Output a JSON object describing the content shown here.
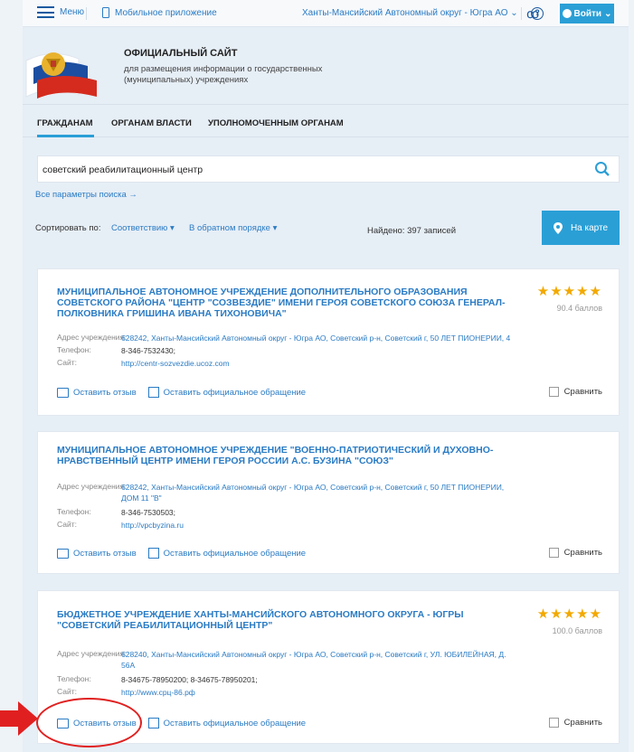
{
  "topbar": {
    "menu_label": "Меню",
    "mobile_label": "Мобильное приложение",
    "region": "Ханты-Мансийский Автономный округ - Югра АО",
    "login_label": "Войти"
  },
  "header": {
    "title": "ОФИЦИАЛЬНЫЙ САЙТ",
    "subtitle_line1": "для размещения информации о государственных",
    "subtitle_line2": "(муниципальных) учреждениях"
  },
  "nav": {
    "items": [
      "ГРАЖДАНАМ",
      "ОРГАНАМ ВЛАСТИ",
      "УПОЛНОМОЧЕННЫМ ОРГАНАМ"
    ],
    "active": "ГРАЖДАНАМ"
  },
  "search": {
    "value": "советский реабилитационный центр",
    "all_params": "Все параметры поиска →"
  },
  "sort": {
    "label": "Сортировать по:",
    "option1": "Соответствию",
    "option2": "В обратном порядке",
    "found": "Найдено: 397 записей",
    "map_button": "На карте"
  },
  "labels": {
    "address": "Адрес учреждения:",
    "phone": "Телефон:",
    "site": "Сайт:",
    "review": "Оставить отзыв",
    "appeal": "Оставить официальное обращение",
    "compare": "Сравнить"
  },
  "cards": [
    {
      "title": "МУНИЦИПАЛЬНОЕ АВТОНОМНОЕ УЧРЕЖДЕНИЕ ДОПОЛНИТЕЛЬНОГО ОБРАЗОВАНИЯ СОВЕТСКОГО РАЙОНА \"ЦЕНТР \"СОЗВЕЗДИЕ\" ИМЕНИ ГЕРОЯ СОВЕТСКОГО СОЮЗА ГЕНЕРАЛ-ПОЛКОВНИКА ГРИШИНА ИВАНА ТИХОНОВИЧА\"",
      "stars": "★★★★★",
      "score": "90.4 баллов",
      "address": "628242, Ханты-Мансийский Автономный округ - Югра АО, Советский р-н, Советский г, 50 ЛЕТ ПИОНЕРИИ, 4",
      "phone": "8-346-7532430;",
      "site": "http://centr-sozvezdie.ucoz.com"
    },
    {
      "title": "МУНИЦИПАЛЬНОЕ АВТОНОМНОЕ УЧРЕЖДЕНИЕ \"ВОЕННО-ПАТРИОТИЧЕСКИЙ И ДУХОВНО-НРАВСТВЕННЫЙ ЦЕНТР ИМЕНИ ГЕРОЯ РОССИИ А.С. БУЗИНА \"СОЮЗ\"",
      "address": "628242, Ханты-Мансийский Автономный округ - Югра АО, Советский р-н, Советский г, 50 ЛЕТ ПИОНЕРИИ, ДОМ 11 \"В\"",
      "phone": "8-346-7530503;",
      "site": "http://vpcbyzina.ru"
    },
    {
      "title": "БЮДЖЕТНОЕ УЧРЕЖДЕНИЕ ХАНТЫ-МАНСИЙСКОГО АВТОНОМНОГО ОКРУГА - ЮГРЫ \"СОВЕТСКИЙ РЕАБИЛИТАЦИОННЫЙ ЦЕНТР\"",
      "stars": "★★★★★",
      "score": "100.0 баллов",
      "address": "628240, Ханты-Мансийский Автономный округ - Югра АО, Советский р-н, Советский г, УЛ. ЮБИЛЕЙНАЯ, Д. 56А",
      "phone": "8-34675-78950200; 8-34675-78950201;",
      "site": "http://www.cpц-86.рф"
    }
  ],
  "colors": {
    "accent": "#2a9fd6",
    "link": "#2a7bc4",
    "star": "#f2a900",
    "annotation": "#e02020"
  }
}
